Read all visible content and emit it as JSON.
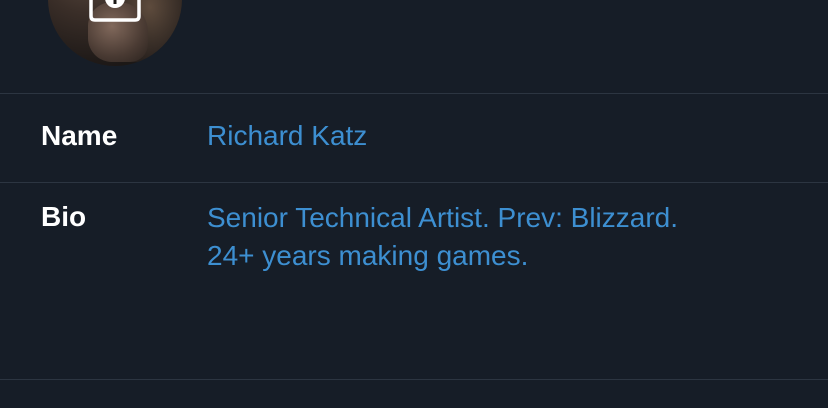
{
  "profile": {
    "avatar_icon": "camera-plus-icon",
    "name_label": "Name",
    "name_value": "Richard Katz",
    "bio_label": "Bio",
    "bio_lines": [
      "Senior Technical Artist. Prev: Blizzard.",
      "24+ years making games."
    ]
  },
  "colors": {
    "background": "#161d27",
    "label": "#ffffff",
    "value": "#3d8fd1",
    "divider": "#2c3541"
  }
}
